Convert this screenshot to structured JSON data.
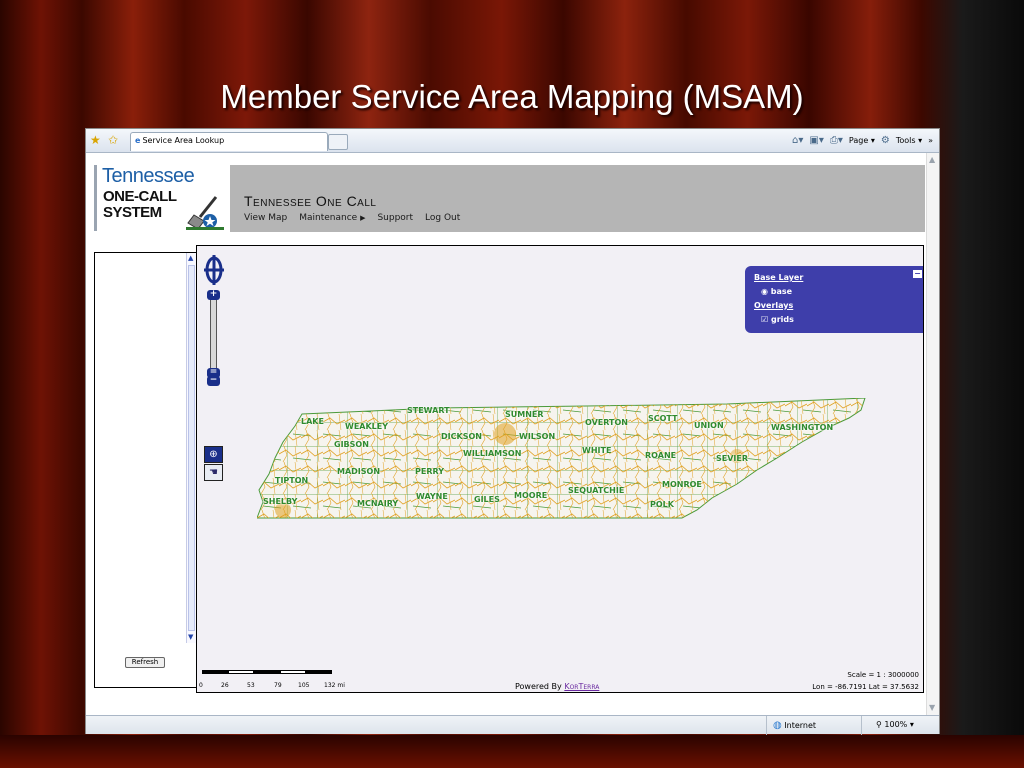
{
  "slide": {
    "title": "Member Service Area Mapping (MSAM)"
  },
  "browser": {
    "tab_label": "Service Area Lookup",
    "commands": [
      "Page ▾",
      "Tools ▾"
    ],
    "status": {
      "zone": "Internet",
      "zoom": "100%"
    }
  },
  "logo": {
    "line1": "Tennessee",
    "line2": "ONE-CALL",
    "line3": "SYSTEM"
  },
  "header": {
    "title": "Tennessee One Call",
    "nav": [
      "View Map",
      "Maintenance",
      "Support",
      "Log Out"
    ]
  },
  "sidebar": {
    "refresh_label": "Refresh"
  },
  "map": {
    "layer_switcher": {
      "base_header": "Base Layer",
      "base_item": "base",
      "overlays_header": "Overlays",
      "overlay_item": "grids"
    },
    "counties": [
      {
        "name": "STEWART"
      },
      {
        "name": "SUMNER"
      },
      {
        "name": "OVERTON"
      },
      {
        "name": "SCOTT"
      },
      {
        "name": "LAKE"
      },
      {
        "name": "WEAKLEY"
      },
      {
        "name": "UNION"
      },
      {
        "name": "WASHINGTON"
      },
      {
        "name": "DICKSON"
      },
      {
        "name": "WILSON"
      },
      {
        "name": "GIBSON"
      },
      {
        "name": "WHITE"
      },
      {
        "name": "WILLIAMSON"
      },
      {
        "name": "ROANE"
      },
      {
        "name": "SEVIER"
      },
      {
        "name": "MADISON"
      },
      {
        "name": "PERRY"
      },
      {
        "name": "TIPTON"
      },
      {
        "name": "SEQUATCHIE"
      },
      {
        "name": "MONROE"
      },
      {
        "name": "WAYNE"
      },
      {
        "name": "GILES"
      },
      {
        "name": "MOORE"
      },
      {
        "name": "SHELBY"
      },
      {
        "name": "MCNAIRY"
      },
      {
        "name": "POLK"
      }
    ],
    "scale_ticks": [
      "0",
      "26",
      "53",
      "79",
      "105",
      "132 mi"
    ],
    "scale_text": "Scale = 1 : 3000000",
    "lonlat_text": "Lon = -86.7191 Lat = 37.5632",
    "powered_prefix": "Powered By ",
    "powered_link": "KorTerra"
  },
  "colors": {
    "map_panel": "#3e3eaa",
    "header_band": "#b5b5b5",
    "roads": "#e0a020",
    "county_lines": "#4a9a3a"
  }
}
